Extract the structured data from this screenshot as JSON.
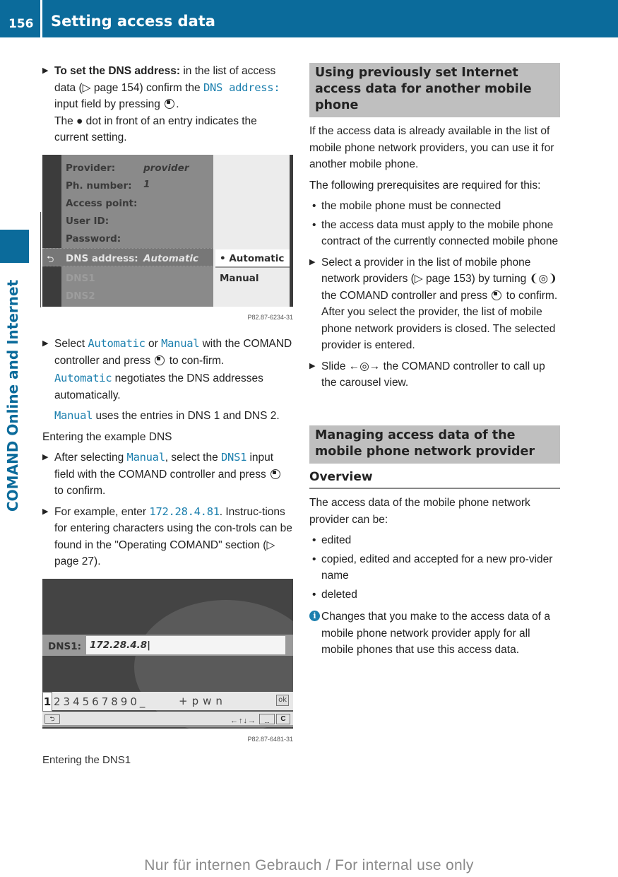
{
  "header": {
    "page_number": "156",
    "title": "Setting access data"
  },
  "side_tab": {
    "label": "COMAND Online and Internet"
  },
  "left_column": {
    "step1": {
      "bold_lead": "To set the DNS address:",
      "text_a": " in the list of access data (",
      "page_ref_symbol": "▷",
      "text_b": " page 154) confirm the ",
      "code": "DNS address:",
      "text_c": " input field by pressing ",
      "text_d": ".",
      "note": "The ● dot in front of an entry indicates the current setting."
    },
    "screenshot1": {
      "rows": [
        {
          "label": "Provider:",
          "value": "provider 1"
        },
        {
          "label": "Ph. number:",
          "value": ""
        },
        {
          "label": "Access point:",
          "value": ""
        },
        {
          "label": "User ID:",
          "value": ""
        },
        {
          "label": "Password:",
          "value": ""
        }
      ],
      "selected_row": {
        "label": "DNS address:",
        "value": "Automatic"
      },
      "dim_rows": [
        "DNS1",
        "DNS2"
      ],
      "options": [
        {
          "label": "• Automatic",
          "selected": true
        },
        {
          "label": "Manual",
          "selected": false
        }
      ],
      "code": "P82.87-6234-31"
    },
    "step2": {
      "text_a": "Select ",
      "code_a": "Automatic",
      "text_b": " or ",
      "code_b": "Manual",
      "text_c": " with the COMAND controller and press ",
      "text_d": " to con-firm."
    },
    "auto_note": {
      "code": "Automatic",
      "text": " negotiates the DNS addresses automatically."
    },
    "manual_note": {
      "code": "Manual",
      "text": " uses the entries in DNS 1 and DNS 2."
    },
    "example_heading": "Entering the example DNS",
    "step3": {
      "text_a": "After selecting ",
      "code_a": "Manual",
      "text_b": ", select the ",
      "code_b": "DNS1",
      "text_c": " input field with the COMAND controller and press ",
      "text_d": " to confirm."
    },
    "step4": {
      "text_a": "For example, enter ",
      "code_a": "172.28.4.81",
      "text_b": ". Instruc-tions for entering characters using the con-trols can be found in the \"Operating COMAND\" section (",
      "page_ref_symbol": "▷",
      "text_c": " page 27)."
    },
    "screenshot2": {
      "field_label": "DNS1:",
      "field_value": "172.28.4.8|",
      "char_first": "1",
      "char_rest": "234567890_",
      "char_extra": "+pwn",
      "ok_label": "ok",
      "back_label": "⮌",
      "arrows": "←↑↓→",
      "dots_label": "...",
      "clear_label": "C",
      "code": "P82.87-6481-31"
    },
    "caption": "Entering the DNS1"
  },
  "right_column": {
    "section1": {
      "heading": "Using previously set Internet access data for another mobile phone",
      "para1": "If the access data is already available in the list of mobile phone network providers, you can use it for another mobile phone.",
      "para2": "The following prerequisites are required for this:",
      "bullets": [
        "the mobile phone must be connected",
        "the access data must apply to the mobile phone contract of the currently connected mobile phone"
      ],
      "step1": {
        "text_a": "Select a provider in the list of mobile phone network providers (",
        "page_ref_symbol": "▷",
        "text_b": " page 153) by turning ",
        "turn_symbol": "❨◎❩",
        "text_c": " the COMAND controller and press ",
        "text_d": " to confirm.",
        "note": "After you select the provider, the list of mobile phone network providers is closed. The selected provider is entered."
      },
      "step2": {
        "text_a": "Slide ",
        "slide_symbol": "←◎→",
        "text_b": " the COMAND controller to call up the carousel view."
      }
    },
    "section2": {
      "heading": "Managing access data of the mobile phone network provider",
      "subheading": "Overview",
      "para1": "The access data of the mobile phone network provider can be:",
      "bullets": [
        "edited",
        "copied, edited and accepted for a new pro-vider name",
        "deleted"
      ],
      "info": "Changes that you make to the access data of a mobile phone network provider apply for all mobile phones that use this access data."
    }
  },
  "footer": {
    "watermark": "Nur für internen Gebrauch / For internal use only"
  },
  "colors": {
    "brand_blue": "#0b6b9b",
    "code_blue": "#1b7fae",
    "section_gray": "#bfbfbf"
  }
}
